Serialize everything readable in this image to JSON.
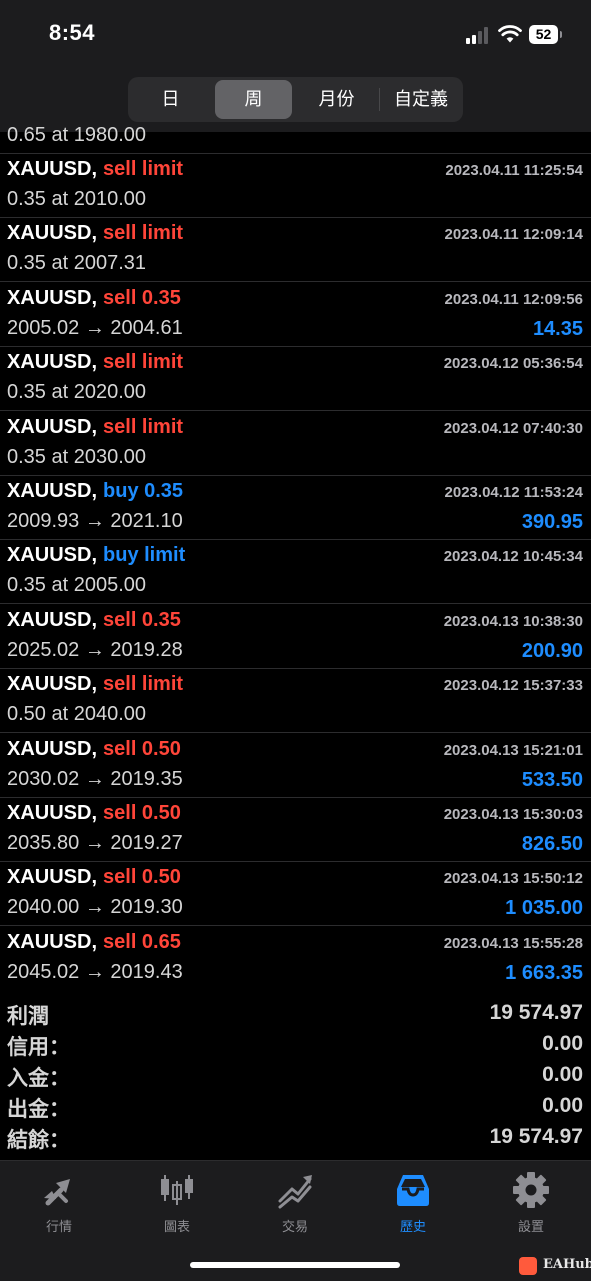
{
  "status_bar": {
    "time": "8:54",
    "battery": "52"
  },
  "period_tabs": [
    {
      "label": "日",
      "active": false
    },
    {
      "label": "周",
      "active": true
    },
    {
      "label": "月份",
      "active": false
    },
    {
      "label": "自定義",
      "active": false
    }
  ],
  "partial_row": {
    "detail": "0.65 at 1980.00"
  },
  "orders": [
    {
      "symbol": "XAUUSD,",
      "type": "sell limit",
      "side": "sell",
      "datetime": "2023.04.11 11:25:54",
      "detail": "0.35 at 2010.00",
      "profit": ""
    },
    {
      "symbol": "XAUUSD,",
      "type": "sell limit",
      "side": "sell",
      "datetime": "2023.04.11 12:09:14",
      "detail": "0.35 at 2007.31",
      "profit": ""
    },
    {
      "symbol": "XAUUSD,",
      "type": "sell 0.35",
      "side": "sell",
      "datetime": "2023.04.11 12:09:56",
      "detail": "2005.02 → 2004.61",
      "profit": "14.35"
    },
    {
      "symbol": "XAUUSD,",
      "type": "sell limit",
      "side": "sell",
      "datetime": "2023.04.12 05:36:54",
      "detail": "0.35 at 2020.00",
      "profit": ""
    },
    {
      "symbol": "XAUUSD,",
      "type": "sell limit",
      "side": "sell",
      "datetime": "2023.04.12 07:40:30",
      "detail": "0.35 at 2030.00",
      "profit": ""
    },
    {
      "symbol": "XAUUSD,",
      "type": "buy 0.35",
      "side": "buy",
      "datetime": "2023.04.12 11:53:24",
      "detail": "2009.93 → 2021.10",
      "profit": "390.95"
    },
    {
      "symbol": "XAUUSD,",
      "type": "buy limit",
      "side": "buy",
      "datetime": "2023.04.12 10:45:34",
      "detail": "0.35 at 2005.00",
      "profit": ""
    },
    {
      "symbol": "XAUUSD,",
      "type": "sell 0.35",
      "side": "sell",
      "datetime": "2023.04.13 10:38:30",
      "detail": "2025.02 → 2019.28",
      "profit": "200.90"
    },
    {
      "symbol": "XAUUSD,",
      "type": "sell limit",
      "side": "sell",
      "datetime": "2023.04.12 15:37:33",
      "detail": "0.50 at 2040.00",
      "profit": ""
    },
    {
      "symbol": "XAUUSD,",
      "type": "sell 0.50",
      "side": "sell",
      "datetime": "2023.04.13 15:21:01",
      "detail": "2030.02 → 2019.35",
      "profit": "533.50"
    },
    {
      "symbol": "XAUUSD,",
      "type": "sell 0.50",
      "side": "sell",
      "datetime": "2023.04.13 15:30:03",
      "detail": "2035.80 → 2019.27",
      "profit": "826.50"
    },
    {
      "symbol": "XAUUSD,",
      "type": "sell 0.50",
      "side": "sell",
      "datetime": "2023.04.13 15:50:12",
      "detail": "2040.00 → 2019.30",
      "profit": "1 035.00"
    },
    {
      "symbol": "XAUUSD,",
      "type": "sell 0.65",
      "side": "sell",
      "datetime": "2023.04.13 15:55:28",
      "detail": "2045.02 → 2019.43",
      "profit": "1 663.35"
    }
  ],
  "summary": [
    {
      "label": "利潤",
      "value": "19 574.97"
    },
    {
      "label": "信用：",
      "value": "0.00"
    },
    {
      "label": "入金：",
      "value": "0.00"
    },
    {
      "label": "出金：",
      "value": "0.00"
    },
    {
      "label": "結餘：",
      "value": "19 574.97"
    }
  ],
  "tab_bar": [
    {
      "label": "行情",
      "icon": "quotes-arrows-icon",
      "active": false
    },
    {
      "label": "圖表",
      "icon": "candlestick-chart-icon",
      "active": false
    },
    {
      "label": "交易",
      "icon": "trade-trend-icon",
      "active": false
    },
    {
      "label": "歷史",
      "icon": "history-tray-icon",
      "active": true
    },
    {
      "label": "設置",
      "icon": "gear-icon",
      "active": false
    }
  ],
  "watermark": "EAHub",
  "colors": {
    "sell": "#ff4539",
    "buy": "#1e8dff",
    "profit": "#1e8dff",
    "background": "#000000",
    "bar": "#1c1c1e"
  }
}
